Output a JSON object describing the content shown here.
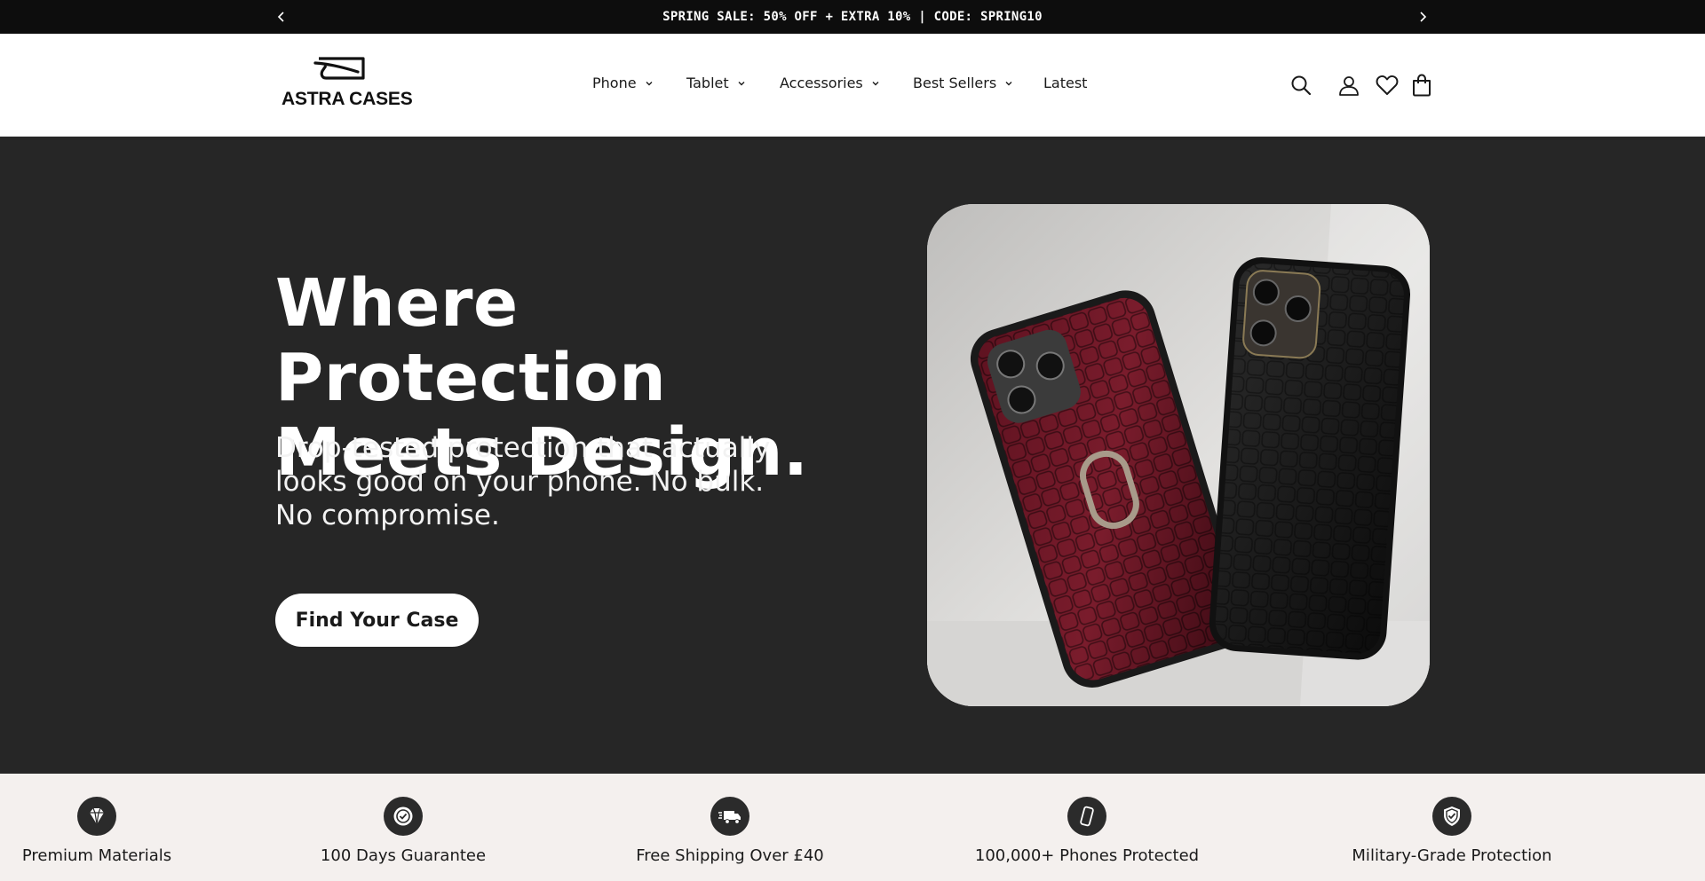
{
  "announcement": {
    "text": "SPRING SALE: 50% OFF + EXTRA 10% | CODE: SPRING10",
    "prev_icon": "chevron-left-icon",
    "next_icon": "chevron-right-icon"
  },
  "header": {
    "logo_text": "ASTRA CASES",
    "nav": [
      {
        "label": "Phone",
        "has_dropdown": true
      },
      {
        "label": "Tablet",
        "has_dropdown": true
      },
      {
        "label": "Accessories",
        "has_dropdown": true
      },
      {
        "label": "Best Sellers",
        "has_dropdown": true
      },
      {
        "label": "Latest",
        "has_dropdown": false
      }
    ],
    "icons": [
      "search-icon",
      "account-icon",
      "wishlist-heart-icon",
      "cart-bag-icon"
    ]
  },
  "hero": {
    "title": "Where Protection Meets Design.",
    "subtitle": "Drop-tested protection that actually looks good on your phone. No bulk. No compromise.",
    "cta_label": "Find Your Case",
    "background_color": "#262626"
  },
  "features": [
    {
      "label": "Premium Materials",
      "icon": "diamond-icon"
    },
    {
      "label": "100 Days Guarantee",
      "icon": "badge-check-icon"
    },
    {
      "label": "Free Shipping Over £40",
      "icon": "delivery-truck-icon"
    },
    {
      "label": "100,000+ Phones Protected",
      "icon": "phone-icon"
    },
    {
      "label": "Military-Grade Protection",
      "icon": "shield-check-icon"
    }
  ]
}
